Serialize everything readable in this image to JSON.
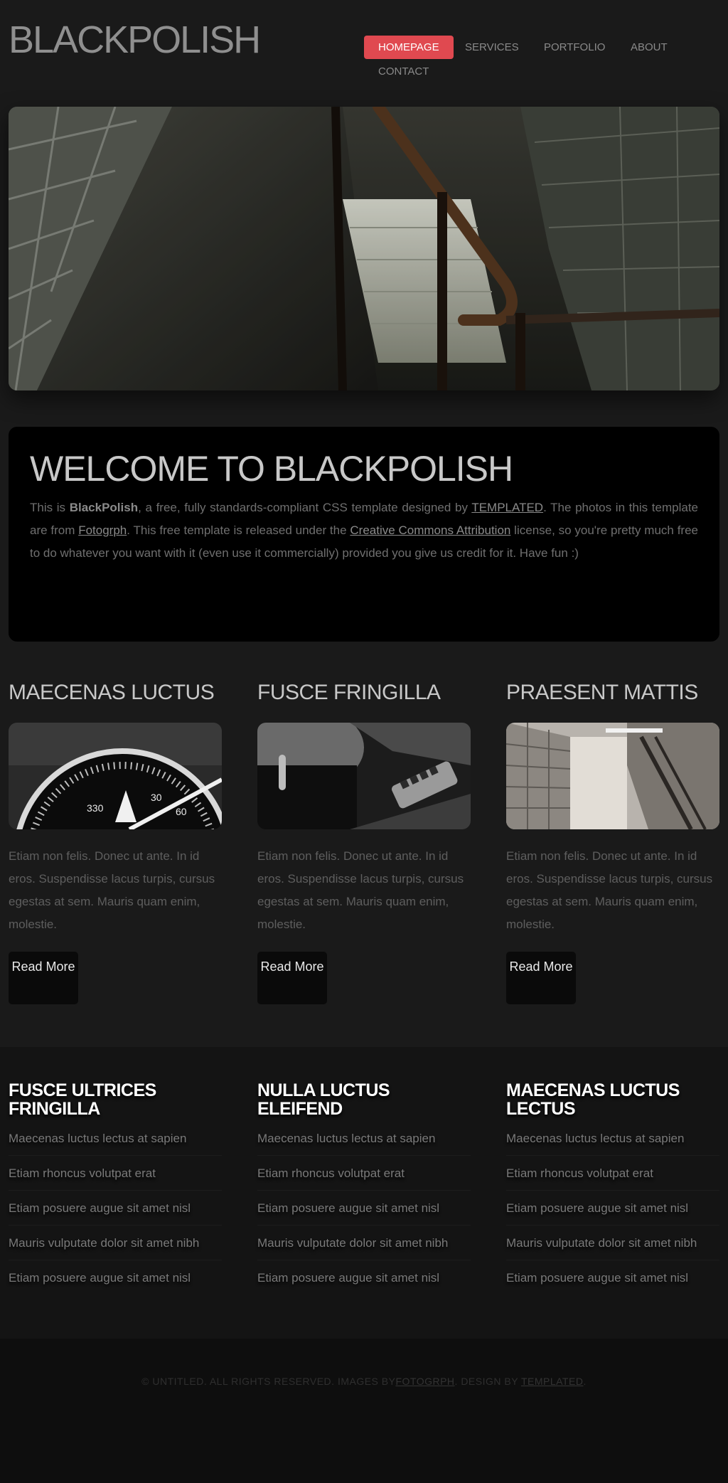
{
  "site": {
    "logo": "BLACKPOLISH"
  },
  "nav": {
    "items": [
      {
        "label": "Homepage",
        "active": true
      },
      {
        "label": "Services",
        "active": false
      },
      {
        "label": "Portfolio",
        "active": false
      },
      {
        "label": "About",
        "active": false
      },
      {
        "label": "Contact",
        "active": false
      }
    ],
    "accent_color": "#e04950"
  },
  "welcome": {
    "title": "Welcome to BlackPolish",
    "text_1": "This is ",
    "brand": "BlackPolish",
    "text_2": ", a free, fully standards-compliant CSS template designed by ",
    "link_templated": "TEMPLATED",
    "text_3": ". The photos in this template are from ",
    "link_fotogrph": "Fotogrph",
    "text_4": ". This free template is released under the ",
    "link_cc": "Creative Commons Attribution",
    "text_5": " license, so you're pretty much free to do whatever you want with it (even use it commercially) provided you give us credit for it. Have fun :)"
  },
  "columns": [
    {
      "title": "Maecenas luctus",
      "image": "compass-photo",
      "text": "Etiam non felis. Donec ut ante. In id eros. Suspendisse lacus turpis, cursus egestas at sem. Mauris quam enim, molestie.",
      "button": "Read More"
    },
    {
      "title": "Fusce fringilla",
      "image": "keyboard-photo",
      "text": "Etiam non felis. Donec ut ante. In id eros. Suspendisse lacus turpis, cursus egestas at sem. Mauris quam enim, molestie.",
      "button": "Read More"
    },
    {
      "title": "Praesent mattis",
      "image": "stairwell-photo",
      "text": "Etiam non felis. Donec ut ante. In id eros. Suspendisse lacus turpis, cursus egestas at sem. Mauris quam enim, molestie.",
      "button": "Read More"
    }
  ],
  "lists": [
    {
      "title": "Fusce ultrices fringilla",
      "items": [
        "Maecenas luctus lectus at sapien",
        "Etiam rhoncus volutpat erat",
        "Etiam posuere augue sit amet nisl",
        "Mauris vulputate dolor sit amet nibh",
        "Etiam posuere augue sit amet nisl"
      ]
    },
    {
      "title": "Nulla luctus eleifend",
      "items": [
        "Maecenas luctus lectus at sapien",
        "Etiam rhoncus volutpat erat",
        "Etiam posuere augue sit amet nisl",
        "Mauris vulputate dolor sit amet nibh",
        "Etiam posuere augue sit amet nisl"
      ]
    },
    {
      "title": "Maecenas luctus lectus",
      "items": [
        "Maecenas luctus lectus at sapien",
        "Etiam rhoncus volutpat erat",
        "Etiam posuere augue sit amet nisl",
        "Mauris vulputate dolor sit amet nibh",
        "Etiam posuere augue sit amet nisl"
      ]
    }
  ],
  "footer": {
    "text_1": "© Untitled. All rights reserved. Images by",
    "link_fotogrph": "Fotogrph",
    "text_2": ". Design by ",
    "link_templated": "TEMPLATED",
    "text_3": "."
  }
}
